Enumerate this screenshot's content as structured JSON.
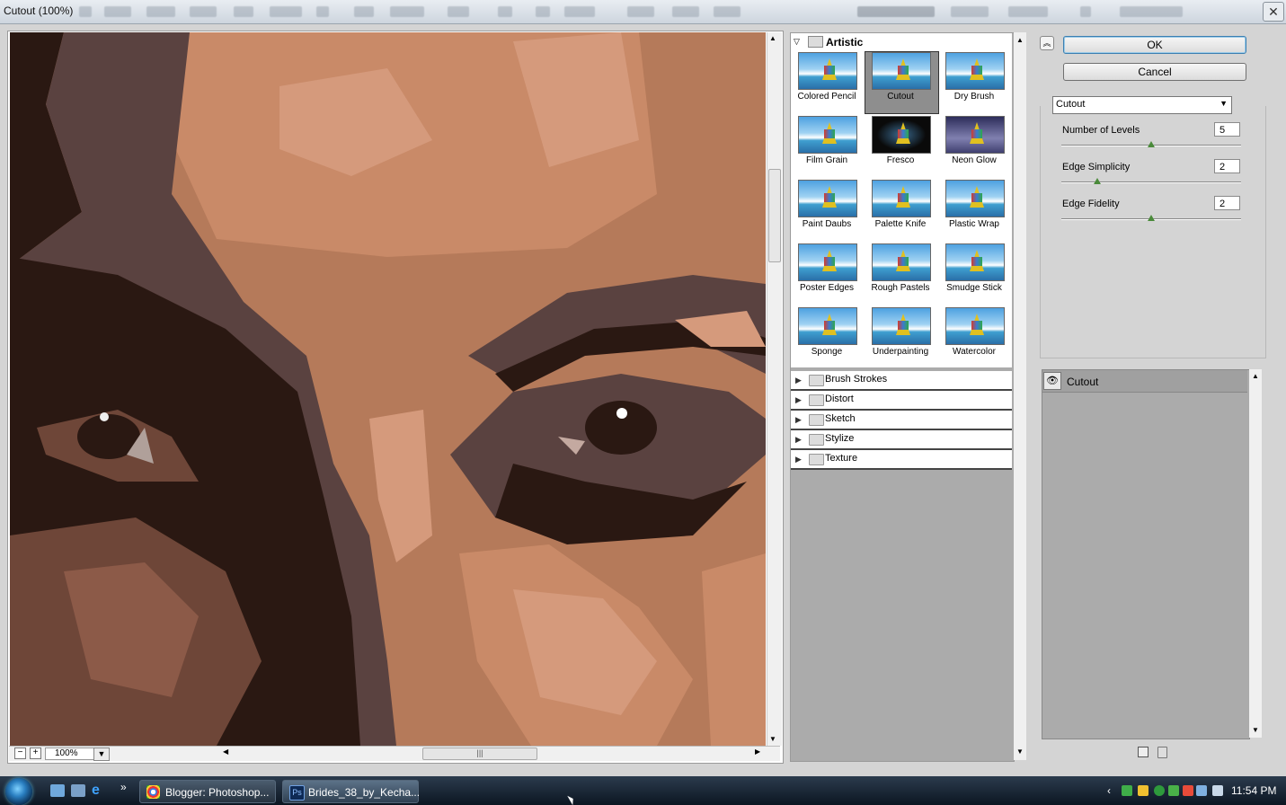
{
  "window": {
    "title": "Cutout (100%)"
  },
  "preview": {
    "zoom_value": "100%",
    "minus": "−",
    "plus": "+"
  },
  "gallery": {
    "open_category": "Artistic",
    "filters": [
      {
        "label": "Colored Pencil"
      },
      {
        "label": "Cutout",
        "selected": true
      },
      {
        "label": "Dry Brush"
      },
      {
        "label": "Film Grain"
      },
      {
        "label": "Fresco"
      },
      {
        "label": "Neon Glow"
      },
      {
        "label": "Paint Daubs"
      },
      {
        "label": "Palette Knife"
      },
      {
        "label": "Plastic Wrap"
      },
      {
        "label": "Poster Edges"
      },
      {
        "label": "Rough Pastels"
      },
      {
        "label": "Smudge Stick"
      },
      {
        "label": "Sponge"
      },
      {
        "label": "Underpainting"
      },
      {
        "label": "Watercolor"
      }
    ],
    "categories": [
      "Brush Strokes",
      "Distort",
      "Sketch",
      "Stylize",
      "Texture"
    ]
  },
  "controls": {
    "ok_label": "OK",
    "cancel_label": "Cancel",
    "filter_select": "Cutout",
    "params": [
      {
        "label": "Number of Levels",
        "value": "5",
        "slider": 0.5
      },
      {
        "label": "Edge Simplicity",
        "value": "2",
        "slider": 0.2
      },
      {
        "label": "Edge Fidelity",
        "value": "2",
        "slider": 0.5
      }
    ]
  },
  "layers": {
    "items": [
      {
        "label": "Cutout",
        "visible": true
      }
    ]
  },
  "taskbar": {
    "tasks": [
      {
        "label": "Blogger: Photoshop...",
        "icon": "chrome-icon"
      },
      {
        "label": "Brides_38_by_Kecha...",
        "icon": "photoshop-icon"
      }
    ],
    "clock": "11:54 PM",
    "overflow": "»"
  },
  "colors": {
    "skin": "#b57a5a",
    "shadow": "#2a1812",
    "mid": "#5a4240",
    "light": "#d59a7c",
    "gallery_bg": "#ababab",
    "ok_accent": "#3c7fb1"
  }
}
